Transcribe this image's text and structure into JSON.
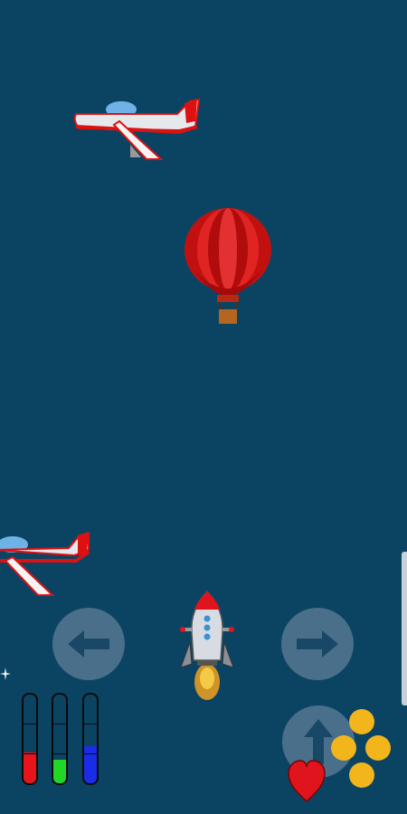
{
  "hud": {
    "score_text": "",
    "gauges": [
      {
        "name": "red-gauge",
        "color": "#e8131b",
        "level": 0.35
      },
      {
        "name": "green-gauge",
        "color": "#22d628",
        "level": 0.27
      },
      {
        "name": "blue-gauge",
        "color": "#1a2ce8",
        "level": 0.42
      }
    ]
  },
  "colors": {
    "background": "#0b4463",
    "button": "#5f7e97",
    "arrow": "#1e4a68",
    "coin": "#f2b51c",
    "heart": "#e0141c",
    "balloon": "#d41414"
  },
  "controls": {
    "left_icon": "arrow-left-icon",
    "right_icon": "arrow-right-icon",
    "up_icon": "arrow-up-icon"
  },
  "sprites": [
    "airplane",
    "hot-air-balloon",
    "airplane",
    "rocket",
    "heart",
    "coins"
  ]
}
